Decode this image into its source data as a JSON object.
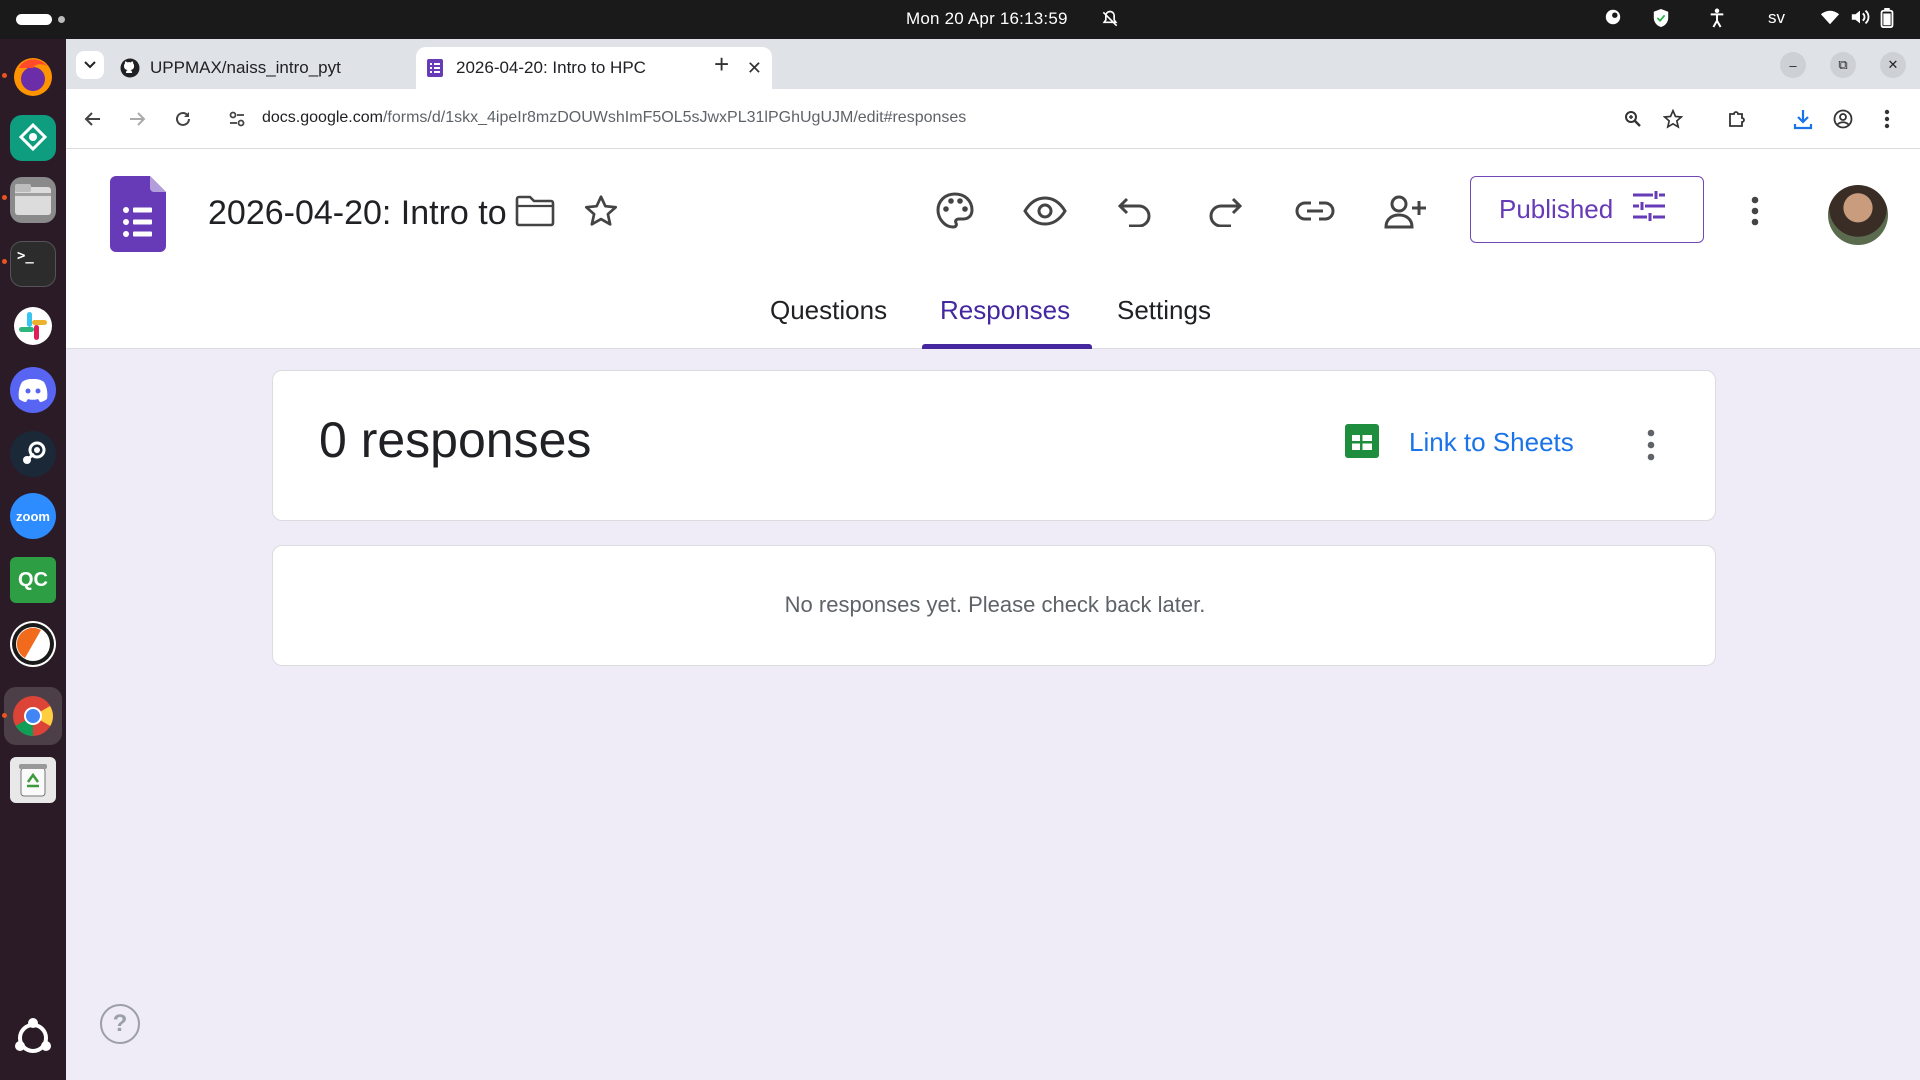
{
  "system": {
    "clock": "Mon 20 Apr  16:13:59",
    "keyboard_layout": "sv"
  },
  "dock": {
    "apps": [
      {
        "name": "firefox-icon",
        "color": "#e66000"
      },
      {
        "name": "sync-app-icon",
        "color": "#0fa88a"
      },
      {
        "name": "files-icon",
        "color": "#7a7a7a"
      },
      {
        "name": "terminal-icon",
        "color": "#2c2c2c"
      },
      {
        "name": "slack-icon",
        "color": "#ffffff"
      },
      {
        "name": "discord-icon",
        "color": "#5865f2"
      },
      {
        "name": "steam-icon",
        "color": "#1b2838"
      },
      {
        "name": "zoom-icon",
        "color": "#2d8cff"
      },
      {
        "name": "qc-icon",
        "color": "#2e9e45"
      },
      {
        "name": "app-icon",
        "color": "#f26b1d"
      },
      {
        "name": "chrome-icon",
        "color": "#4285f4"
      },
      {
        "name": "trash-icon",
        "color": "#ececec"
      }
    ],
    "zoom_label": "zoom",
    "qc_label": "QC"
  },
  "browser": {
    "tabs": [
      {
        "title": "UPPMAX/naiss_intro_pyt",
        "icon": "github-icon"
      },
      {
        "title": "2026-04-20: Intro to HPC",
        "icon": "google-forms-icon"
      }
    ],
    "address": {
      "host": "docs.google.com",
      "path": "/forms/d/1skx_4ipeIr8mzDOUWshImF5OL5sJwxPL31lPGhUgUJM/edit#responses"
    }
  },
  "form": {
    "title": "2026-04-20: Intro to HPC",
    "publish_label": "Published",
    "nav_tabs": [
      {
        "label": "Questions"
      },
      {
        "label": "Responses"
      },
      {
        "label": "Settings"
      }
    ],
    "active_tab": "Responses",
    "responses": {
      "count_label": "0 responses",
      "link_sheets_label": "Link to Sheets",
      "empty_message": "No responses yet. Please check back later."
    },
    "help_label": "?",
    "accent_color": "#673ab7",
    "link_color": "#1a73e8",
    "background_color": "#efebf7"
  }
}
